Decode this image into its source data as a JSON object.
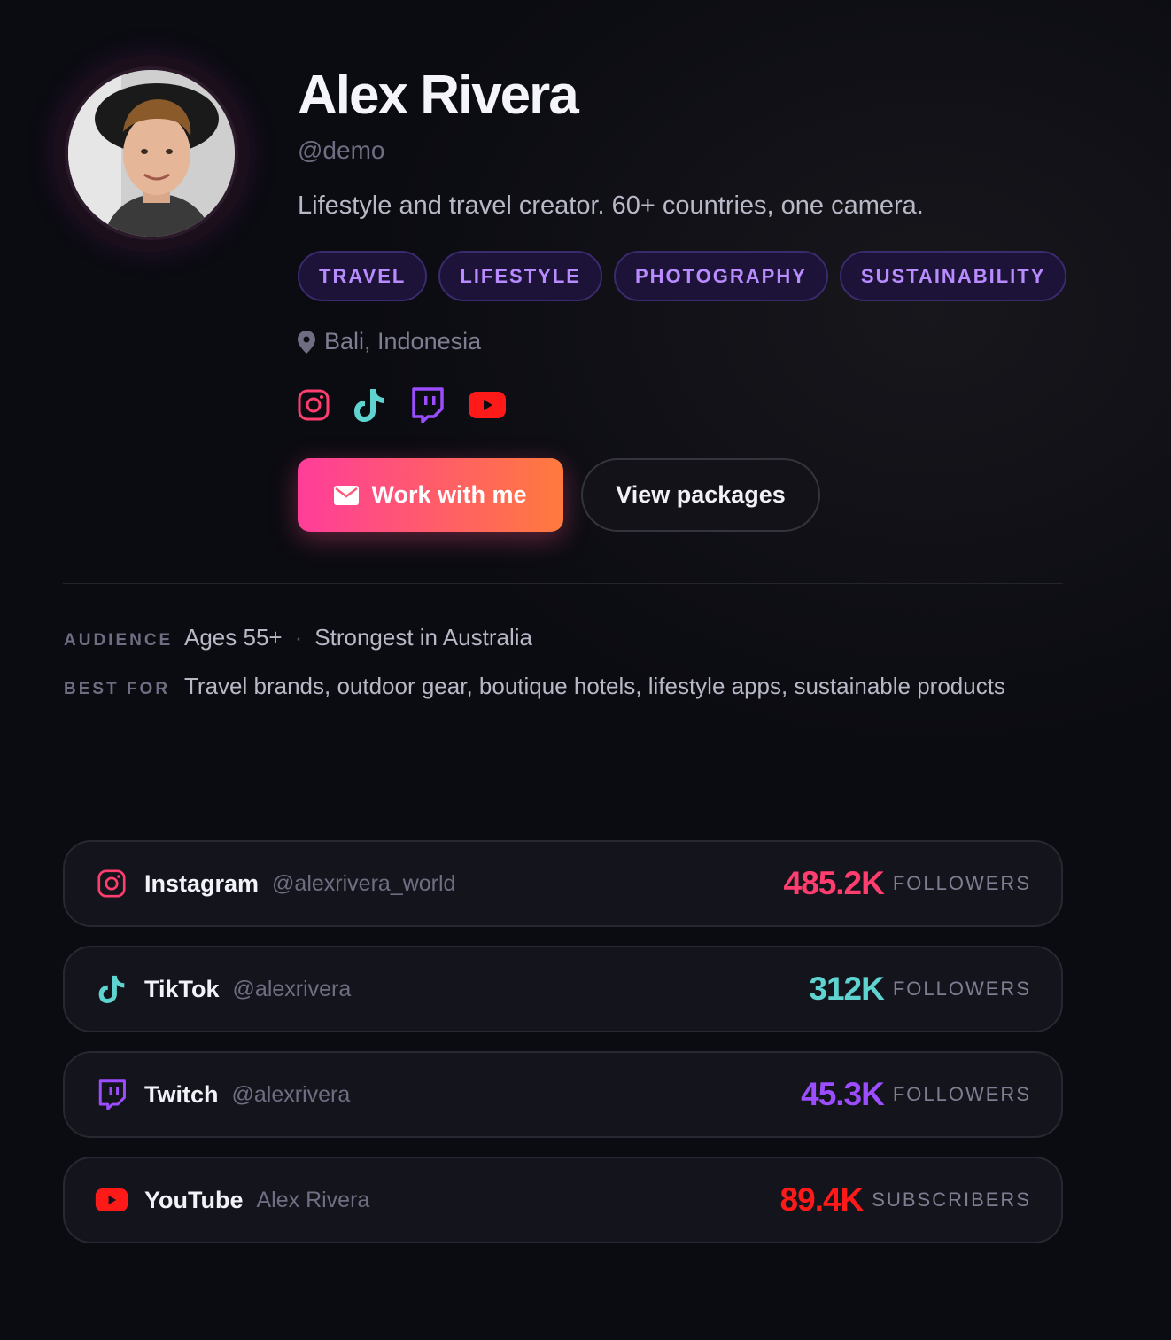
{
  "profile": {
    "name": "Alex Rivera",
    "handle": "@demo",
    "bio": "Lifestyle and travel creator. 60+ countries, one camera.",
    "tags": [
      "TRAVEL",
      "LIFESTYLE",
      "PHOTOGRAPHY",
      "SUSTAINABILITY"
    ],
    "location": "Bali, Indonesia",
    "social_icons": [
      "instagram-icon",
      "tiktok-icon",
      "twitch-icon",
      "youtube-icon"
    ]
  },
  "actions": {
    "primary_label": "Work with me",
    "secondary_label": "View packages"
  },
  "meta": {
    "audience_label": "AUDIENCE",
    "audience_age": "Ages 55+",
    "audience_separator": "·",
    "audience_region": "Strongest in Australia",
    "best_for_label": "BEST FOR",
    "best_for_value": "Travel brands, outdoor gear, boutique hotels, lifestyle apps, sustainable products"
  },
  "platforms": [
    {
      "name": "Instagram",
      "handle": "@alexrivera_world",
      "count": "485.2K",
      "unit": "FOLLOWERS",
      "color": "#ff3d6e",
      "icon": "instagram-icon"
    },
    {
      "name": "TikTok",
      "handle": "@alexrivera",
      "count": "312K",
      "unit": "FOLLOWERS",
      "color": "#5fd3d0",
      "icon": "tiktok-icon"
    },
    {
      "name": "Twitch",
      "handle": "@alexrivera",
      "count": "45.3K",
      "unit": "FOLLOWERS",
      "color": "#9b4dff",
      "icon": "twitch-icon"
    },
    {
      "name": "YouTube",
      "handle": "Alex Rivera",
      "count": "89.4K",
      "unit": "SUBSCRIBERS",
      "color": "#ff1a1a",
      "icon": "youtube-icon"
    }
  ],
  "colors": {
    "background": "#0b0b12",
    "tag_text": "#b88bff",
    "gradient_start": "#ff3d9a",
    "gradient_end": "#ff7a3d"
  }
}
